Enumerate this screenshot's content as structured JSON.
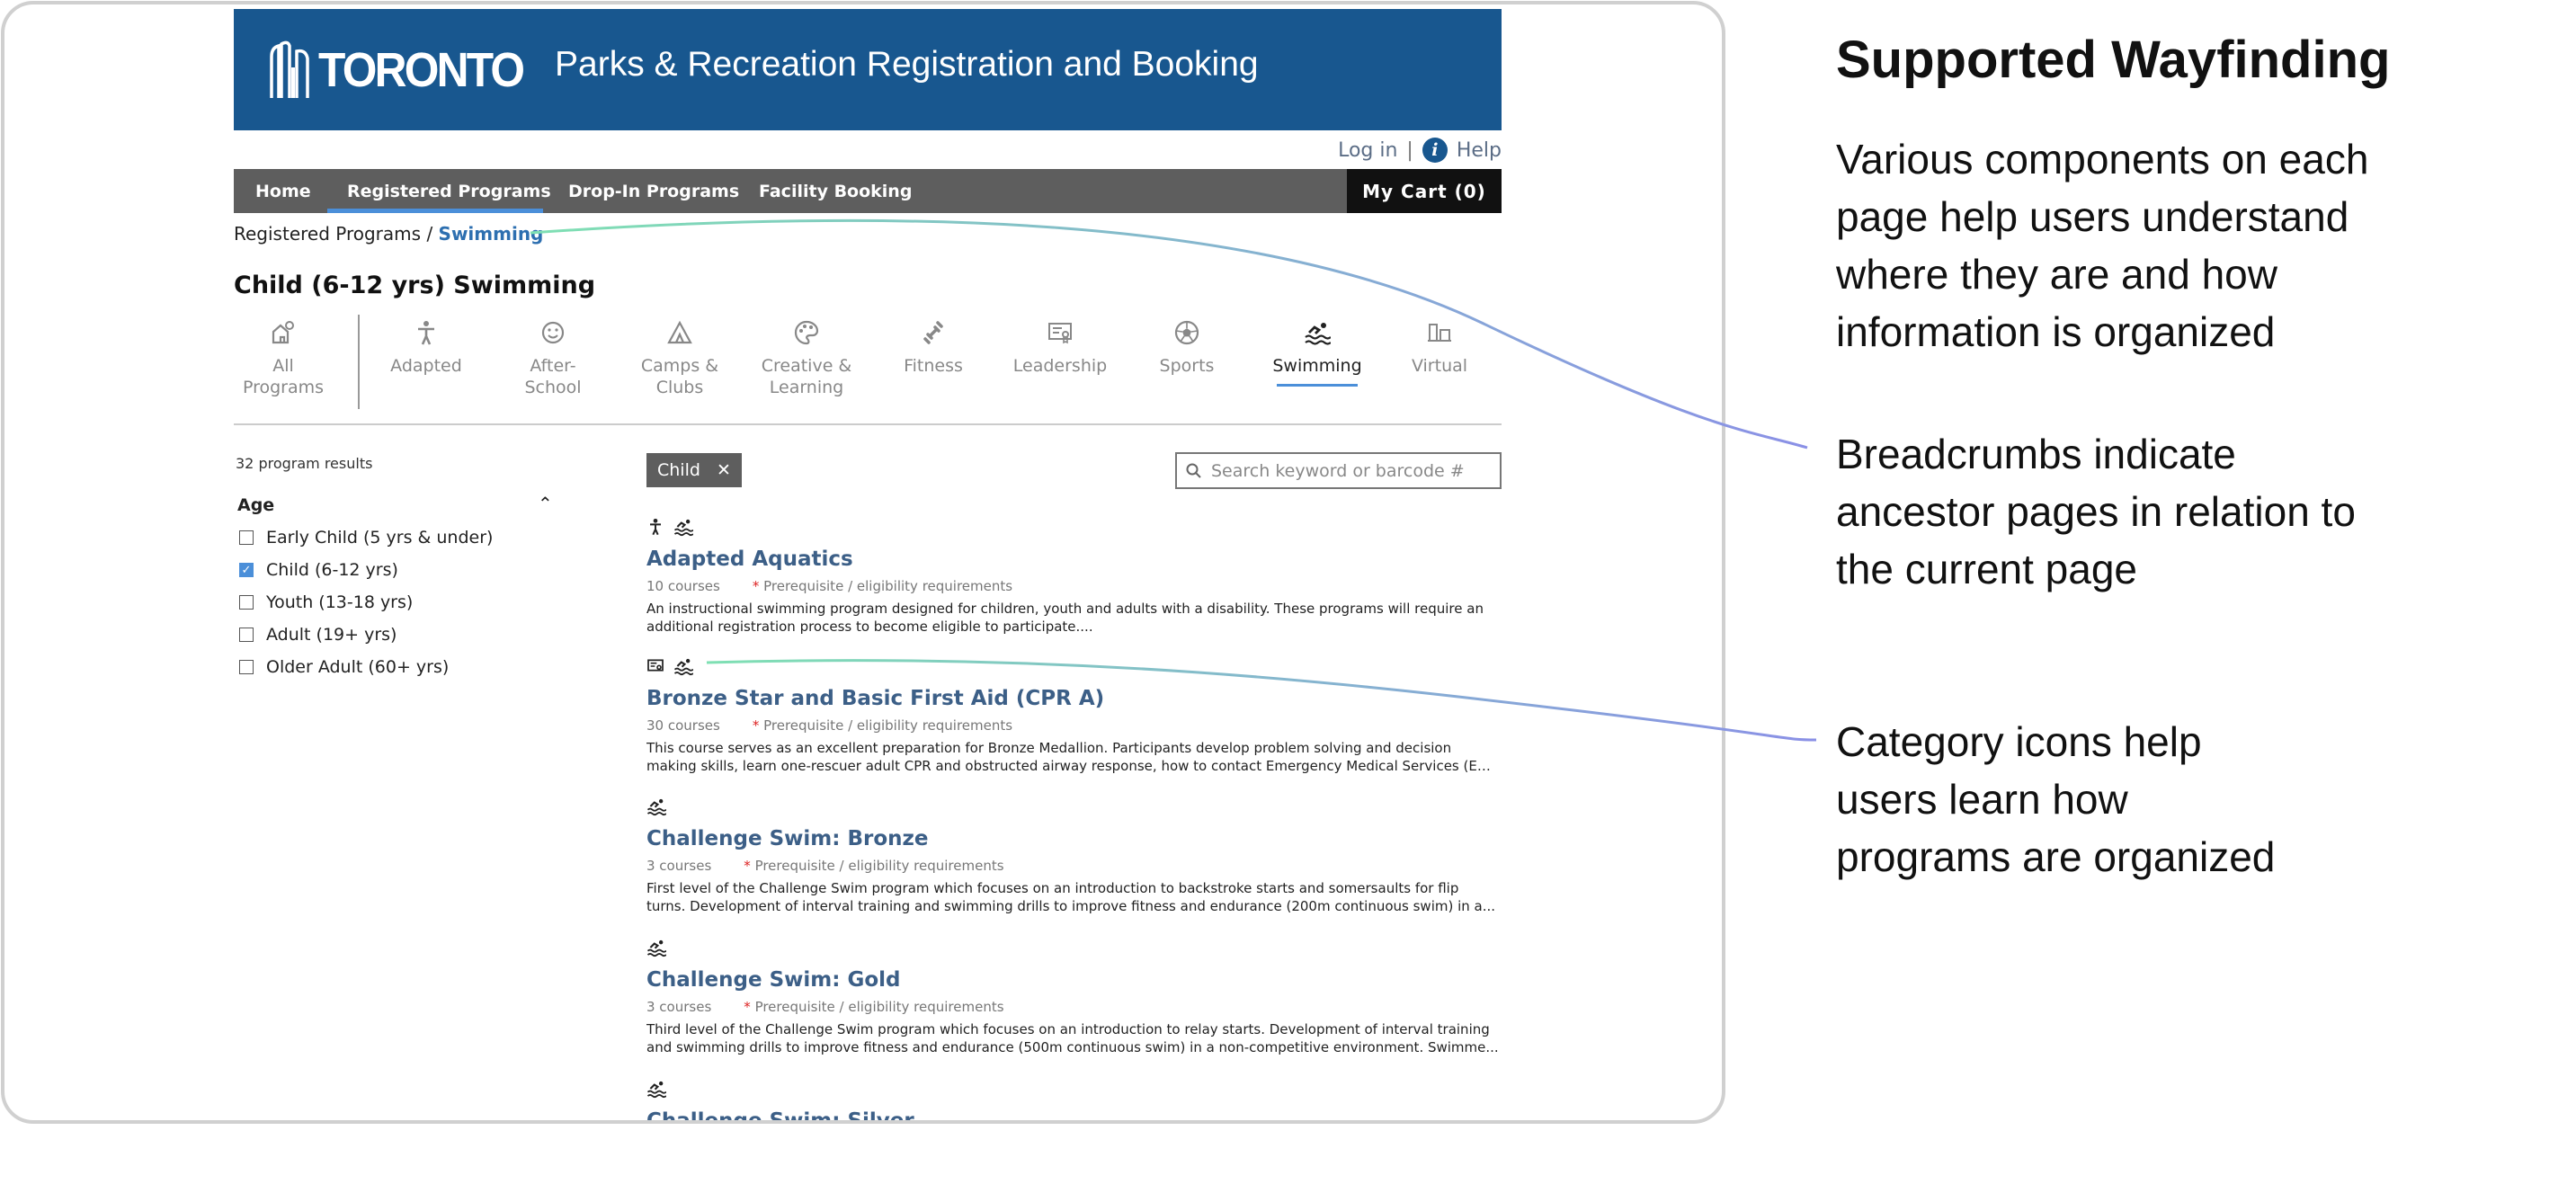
{
  "site": {
    "logo_text": "TORONTO",
    "banner_title": "Parks & Recreation Registration and Booking",
    "login": "Log in",
    "separator": "|",
    "help": "Help",
    "colors": {
      "banner": "#18578f",
      "nav": "#5e5e5e",
      "accent": "#4b8fd9",
      "link": "#3c5f87"
    }
  },
  "nav": {
    "items": [
      "Home",
      "Registered Programs",
      "Drop-In Programs",
      "Facility Booking"
    ],
    "active": "Registered Programs",
    "cart": "My Cart (0)"
  },
  "breadcrumb": {
    "parent": "Registered Programs",
    "separator": "/",
    "current": "Swimming"
  },
  "page_title": "Child (6-12 yrs) Swimming",
  "categories": [
    {
      "l1": "All",
      "l2": "Programs",
      "icon": "all-programs-icon"
    },
    {
      "l1": "Adapted",
      "l2": "",
      "icon": "adapted-icon"
    },
    {
      "l1": "After-",
      "l2": "School",
      "icon": "after-school-icon"
    },
    {
      "l1": "Camps &",
      "l2": "Clubs",
      "icon": "camps-icon"
    },
    {
      "l1": "Creative &",
      "l2": "Learning",
      "icon": "creative-icon"
    },
    {
      "l1": "Fitness",
      "l2": "",
      "icon": "fitness-icon"
    },
    {
      "l1": "Leadership",
      "l2": "",
      "icon": "leadership-icon"
    },
    {
      "l1": "Sports",
      "l2": "",
      "icon": "sports-icon"
    },
    {
      "l1": "Swimming",
      "l2": "",
      "icon": "swimming-icon"
    },
    {
      "l1": "Virtual",
      "l2": "",
      "icon": "virtual-icon"
    }
  ],
  "active_category": "Swimming",
  "filters": {
    "results": "32 program results",
    "age_heading": "Age",
    "options": [
      {
        "label": "Early Child (5 yrs & under)",
        "checked": false
      },
      {
        "label": "Child (6-12 yrs)",
        "checked": true
      },
      {
        "label": "Youth (13-18 yrs)",
        "checked": false
      },
      {
        "label": "Adult (19+ yrs)",
        "checked": false
      },
      {
        "label": "Older Adult (60+ yrs)",
        "checked": false
      }
    ]
  },
  "chip": {
    "label": "Child",
    "remove": "✕"
  },
  "search": {
    "placeholder": "Search keyword or barcode #"
  },
  "programs": [
    {
      "title": "Adapted Aquatics",
      "icons": [
        "adapted-icon",
        "swimming-icon"
      ],
      "courses": "10 courses",
      "prereq_mark": "*",
      "prereq": "Prerequisite / eligibility requirements",
      "desc1": "An instructional swimming program designed for children, youth and adults with a disability. These programs will require an",
      "desc2": "additional registration process to become eligible to participate...."
    },
    {
      "title": "Bronze Star and Basic First Aid (CPR A)",
      "icons": [
        "leadership-icon",
        "swimming-icon"
      ],
      "courses": "30 courses",
      "prereq_mark": "*",
      "prereq": "Prerequisite / eligibility requirements",
      "desc1": "This course serves as an excellent preparation for Bronze Medallion. Participants develop problem solving and decision",
      "desc2": "making skills, learn one-rescuer adult CPR and obstructed airway response, how to contact Emergency Medical Services (EM..."
    },
    {
      "title": "Challenge Swim: Bronze",
      "icons": [
        "swimming-icon"
      ],
      "courses": "3 courses",
      "prereq_mark": "*",
      "prereq": "Prerequisite / eligibility requirements",
      "desc1": "First level of the Challenge Swim program which focuses on an introduction to backstroke starts and somersaults for flip",
      "desc2": "turns. Development of interval training and swimming drills to improve fitness and endurance (200m continuous swim) in a..."
    },
    {
      "title": "Challenge Swim: Gold",
      "icons": [
        "swimming-icon"
      ],
      "courses": "3 courses",
      "prereq_mark": "*",
      "prereq": "Prerequisite / eligibility requirements",
      "desc1": "Third level of the Challenge Swim program which focuses on an introduction to relay starts. Development of interval training",
      "desc2": "and swimming drills to improve fitness and endurance (500m continuous swim) in a non-competitive environment. Swimme..."
    },
    {
      "title": "Challenge Swim: Silver",
      "icons": [
        "swimming-icon"
      ]
    }
  ],
  "annotations": {
    "title": "Supported Wayfinding",
    "intro": [
      "Various components on each",
      "page help users understand",
      "where they are and how",
      "information is organized"
    ],
    "breadcrumbs": [
      "Breadcrumbs indicate",
      "ancestor pages in relation to",
      "the current page"
    ],
    "icons": [
      "Category icons help",
      "users learn how",
      "programs are organized"
    ],
    "line_colors": {
      "start": "#7fe0b3",
      "end": "#8a90e6"
    }
  }
}
